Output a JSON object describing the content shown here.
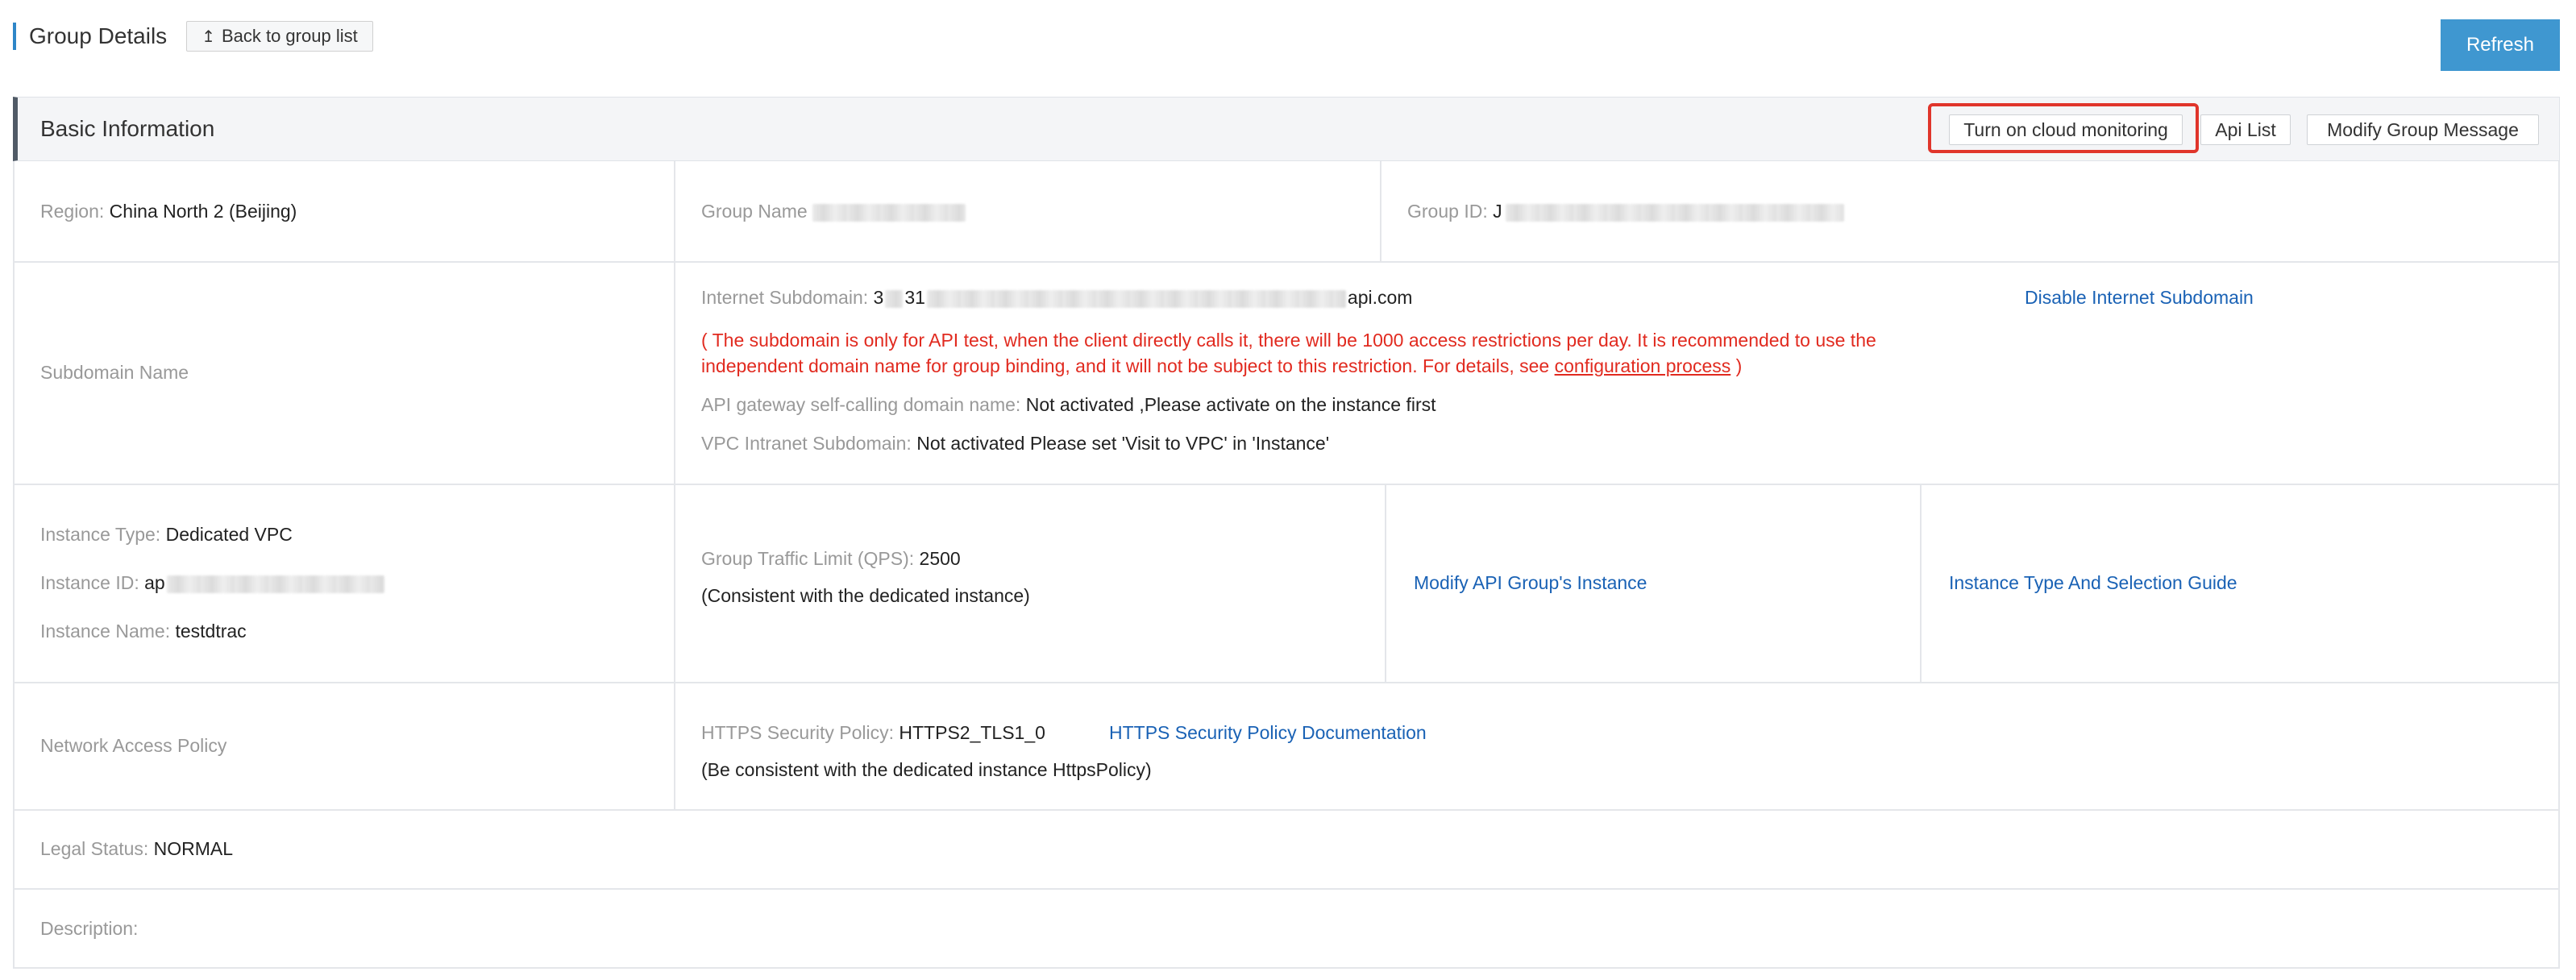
{
  "header": {
    "title": "Group Details",
    "back_label": "Back to group list",
    "refresh_label": "Refresh"
  },
  "section": {
    "title": "Basic Information",
    "buttons": {
      "cloud_monitoring": "Turn on cloud monitoring",
      "api_list": "Api List",
      "modify_group_message": "Modify Group Message"
    }
  },
  "row1": {
    "region_label": "Region: ",
    "region_value": "China North 2 (Beijing)",
    "group_name_label": "Group Name",
    "group_id_label": "Group ID: ",
    "group_id_prefix": "J"
  },
  "subdomain": {
    "label": "Subdomain Name",
    "internet_label": "Internet Subdomain: ",
    "internet_prefix": "3",
    "internet_mid": "31",
    "internet_suffix": "api.com",
    "disable_link": "Disable Internet Subdomain",
    "warning_part1": "( The subdomain is only for API test, when the client directly calls it, there will be 1000 access restrictions per day. It is recommended to use the independent domain name for group binding, and it will not be subject to this restriction. For details, see ",
    "warning_link": "configuration process",
    "warning_part2": " )",
    "self_call_label": "API gateway self-calling domain name: ",
    "self_call_value": "Not activated ,Please activate on the instance first",
    "vpc_label": "VPC Intranet Subdomain: ",
    "vpc_value": "Not activated Please set 'Visit to VPC' in 'Instance'"
  },
  "instance": {
    "type_label": "Instance Type: ",
    "type_value": "Dedicated VPC",
    "id_label": "Instance ID: ",
    "id_prefix": "ap",
    "name_label": "Instance Name: ",
    "name_value": "testdtrac",
    "traffic_label": "Group Traffic Limit (QPS): ",
    "traffic_value": "2500",
    "traffic_note": "(Consistent with the dedicated instance)",
    "modify_link": "Modify API Group's Instance",
    "guide_link": "Instance Type And Selection Guide"
  },
  "network": {
    "label": "Network Access Policy",
    "https_label": "HTTPS Security Policy: ",
    "https_value": "HTTPS2_TLS1_0",
    "https_doc_link": "HTTPS Security Policy Documentation",
    "https_note": "(Be consistent with the dedicated instance HttpsPolicy)"
  },
  "legal": {
    "label": "Legal Status: ",
    "value": "NORMAL"
  },
  "description": {
    "label": "Description:"
  },
  "colors": {
    "accent": "#3f97d0",
    "link": "#1a62b5",
    "warning": "#e12a1f",
    "highlight": "#e0352b"
  }
}
